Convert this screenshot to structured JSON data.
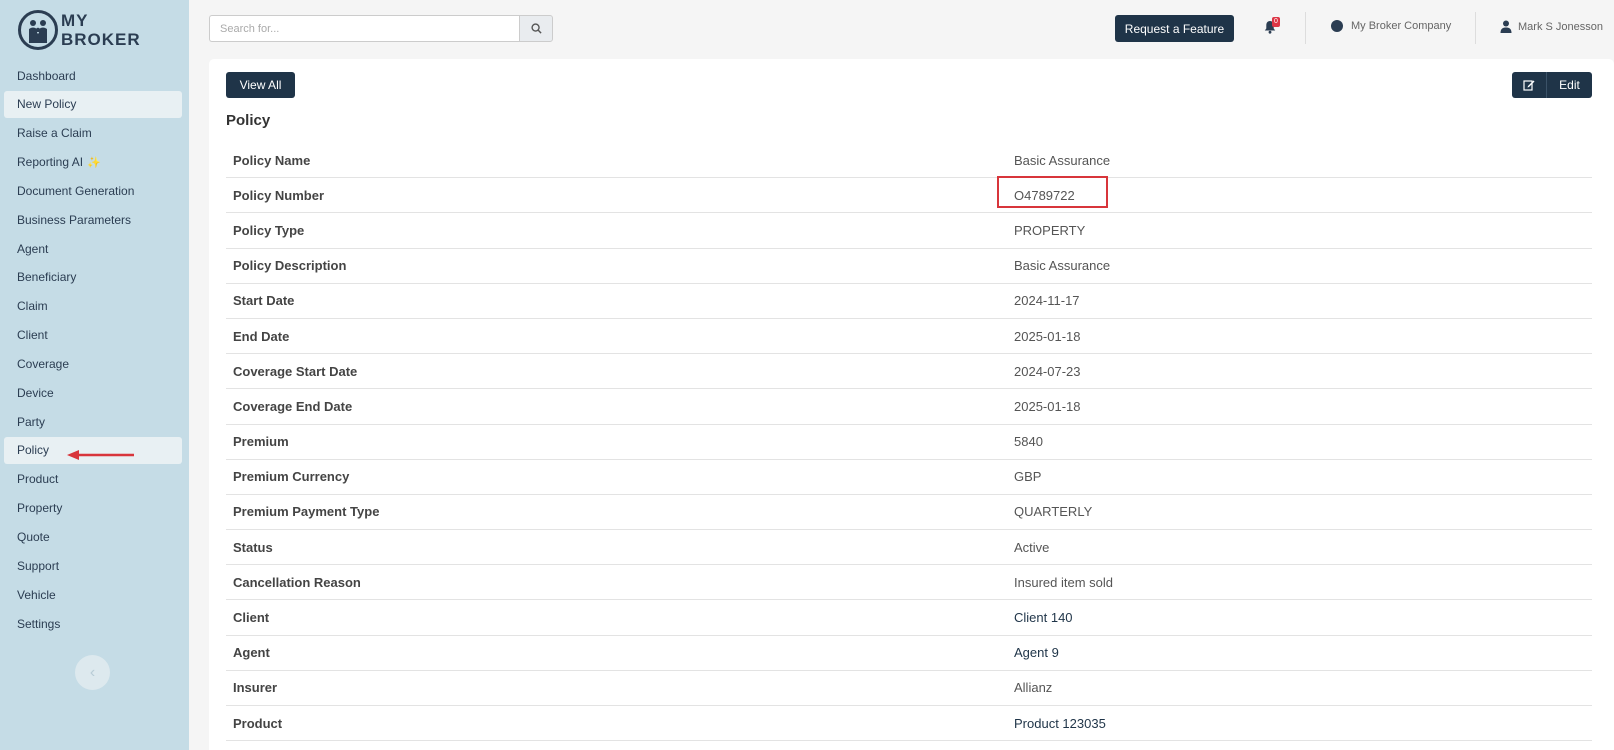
{
  "app": {
    "logo_text_line1": "MY",
    "logo_text_line2": "BROKER"
  },
  "sidebar": {
    "items": [
      {
        "label": "Dashboard"
      },
      {
        "label": "New Policy",
        "active": true
      },
      {
        "label": "Raise a Claim"
      },
      {
        "label": "Reporting AI",
        "sparkle": "✨"
      },
      {
        "label": "Document Generation"
      },
      {
        "label": "Business Parameters"
      },
      {
        "label": "Agent"
      },
      {
        "label": "Beneficiary"
      },
      {
        "label": "Claim"
      },
      {
        "label": "Client"
      },
      {
        "label": "Coverage"
      },
      {
        "label": "Device"
      },
      {
        "label": "Party"
      },
      {
        "label": "Policy",
        "active": true
      },
      {
        "label": "Product"
      },
      {
        "label": "Property"
      },
      {
        "label": "Quote"
      },
      {
        "label": "Support"
      },
      {
        "label": "Vehicle"
      },
      {
        "label": "Settings"
      }
    ],
    "collapse_icon": "chevron-left-icon"
  },
  "topbar": {
    "search_placeholder": "Search for...",
    "request_feature_label": "Request a Feature",
    "notification_count": "0",
    "company_name": "My Broker Company",
    "user_name": "Mark S Jonesson"
  },
  "main": {
    "view_all_label": "View All",
    "edit_label": "Edit",
    "section_title": "Policy",
    "fields": [
      {
        "label": "Policy Name",
        "value": "Basic Assurance"
      },
      {
        "label": "Policy Number",
        "value": "O4789722",
        "highlighted": true
      },
      {
        "label": "Policy Type",
        "value": "PROPERTY"
      },
      {
        "label": "Policy Description",
        "value": "Basic Assurance"
      },
      {
        "label": "Start Date",
        "value": "2024-11-17"
      },
      {
        "label": "End Date",
        "value": "2025-01-18"
      },
      {
        "label": "Coverage Start Date",
        "value": "2024-07-23"
      },
      {
        "label": "Coverage End Date",
        "value": "2025-01-18"
      },
      {
        "label": "Premium",
        "value": "5840"
      },
      {
        "label": "Premium Currency",
        "value": "GBP"
      },
      {
        "label": "Premium Payment Type",
        "value": "QUARTERLY"
      },
      {
        "label": "Status",
        "value": "Active"
      },
      {
        "label": "Cancellation Reason",
        "value": "Insured item sold"
      },
      {
        "label": "Client",
        "value": "Client 140",
        "link": true
      },
      {
        "label": "Agent",
        "value": "Agent 9",
        "link": true
      },
      {
        "label": "Insurer",
        "value": "Allianz"
      },
      {
        "label": "Product",
        "value": "Product 123035",
        "link": true
      }
    ]
  },
  "colors": {
    "sidebar_bg": "#c5dce6",
    "primary_dark": "#1f3448",
    "highlight_red": "#d8353b",
    "badge_red": "#dc3545"
  }
}
